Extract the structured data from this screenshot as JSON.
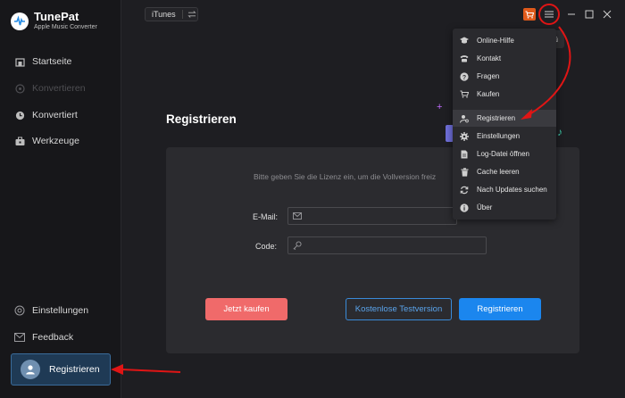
{
  "app": {
    "title": "TunePat",
    "subtitle": "Apple Music Converter"
  },
  "sidebar": {
    "items": [
      {
        "label": "Startseite",
        "icon": "home-icon",
        "enabled": true
      },
      {
        "label": "Konvertieren",
        "icon": "convert-icon",
        "enabled": false
      },
      {
        "label": "Konvertiert",
        "icon": "clock-icon",
        "enabled": true
      },
      {
        "label": "Werkzeuge",
        "icon": "toolbox-icon",
        "enabled": true
      }
    ],
    "bottom_items": [
      {
        "label": "Einstellungen",
        "icon": "settings-icon"
      },
      {
        "label": "Feedback",
        "icon": "mail-icon"
      }
    ],
    "register_label": "Registrieren"
  },
  "topbar": {
    "source": "iTunes",
    "tooltip": "Menü"
  },
  "main": {
    "title": "Registrieren",
    "hint": "Bitte geben Sie die Lizenz ein, um die Vollversion freiz",
    "email_label": "E-Mail:",
    "code_label": "Code:",
    "email_value": "",
    "code_value": "",
    "buy_label": "Jetzt kaufen",
    "trial_label": "Kostenlose Testversion",
    "register_label": "Registrieren"
  },
  "menu": {
    "items": [
      {
        "label": "Online-Hilfe",
        "icon": "graduation-cap-icon"
      },
      {
        "label": "Kontakt",
        "icon": "phone-icon"
      },
      {
        "label": "Fragen",
        "icon": "question-icon"
      },
      {
        "label": "Kaufen",
        "icon": "cart-icon"
      },
      {
        "label": "Registrieren",
        "icon": "user-key-icon",
        "active": true
      },
      {
        "label": "Einstellungen",
        "icon": "gear-icon"
      },
      {
        "label": "Log-Datei öffnen",
        "icon": "file-icon"
      },
      {
        "label": "Cache leeren",
        "icon": "trash-icon"
      },
      {
        "label": "Nach Updates suchen",
        "icon": "refresh-icon"
      },
      {
        "label": "Über",
        "icon": "info-icon"
      }
    ]
  },
  "colors": {
    "accent": "#1b86ee",
    "buy": "#f06a6a",
    "highlight": "#e01515",
    "cart": "#e05a1b"
  }
}
